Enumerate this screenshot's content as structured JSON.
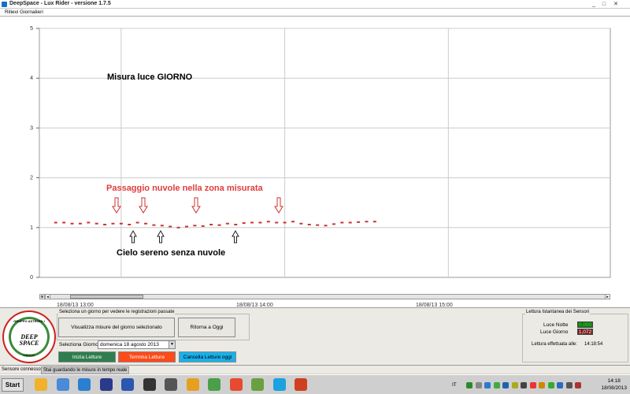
{
  "window": {
    "title": "DeepSpace - Lux Rider - versione 1.7.5"
  },
  "menu": {
    "item": "Rilievi Giornalieri"
  },
  "chart_data": {
    "type": "scatter",
    "title": "",
    "xlabel": "",
    "ylabel": "",
    "ylim": [
      0,
      5
    ],
    "yticks": [
      "0",
      "1",
      "2",
      "3",
      "4",
      "5"
    ],
    "xticks": [
      "18/08/13 13:00",
      "18/08/13 14:00",
      "18/08/13 15:00"
    ],
    "xrange_hours": [
      12.5,
      15.99
    ],
    "grid": true,
    "series": [
      {
        "color": "#cc3333",
        "x": [
          12.6,
          12.65,
          12.7,
          12.75,
          12.8,
          12.85,
          12.9,
          12.95,
          13.0,
          13.05,
          13.1,
          13.15,
          13.2,
          13.25,
          13.3,
          13.35,
          13.4,
          13.45,
          13.5,
          13.55,
          13.6,
          13.65,
          13.7,
          13.75,
          13.8,
          13.85,
          13.9,
          13.95,
          14.0,
          14.05,
          14.1,
          14.15,
          14.2,
          14.25,
          14.3,
          14.35,
          14.4,
          14.45,
          14.5,
          14.55
        ],
        "y": [
          1.1,
          1.1,
          1.08,
          1.08,
          1.1,
          1.08,
          1.06,
          1.08,
          1.08,
          1.06,
          1.1,
          1.08,
          1.05,
          1.04,
          1.02,
          1.0,
          1.02,
          1.04,
          1.03,
          1.06,
          1.05,
          1.08,
          1.06,
          1.09,
          1.1,
          1.1,
          1.12,
          1.1,
          1.1,
          1.12,
          1.08,
          1.06,
          1.05,
          1.04,
          1.07,
          1.1,
          1.1,
          1.11,
          1.12,
          1.12
        ]
      }
    ],
    "annotations": {
      "day": "Misura luce GIORNO",
      "clouds": "Passaggio nuvole nella  zona misurata",
      "clear": "Cielo sereno senza nuvole"
    }
  },
  "controls": {
    "group_past_label": "Seleziona un giorno per vedere le registrazioni passate",
    "view_button": "Visualizza misure del giorno selezionato",
    "today_button": "Ritorna a Oggi",
    "select_day_label": "Seleziona Giorno",
    "date_value": "domenica 18   agosto   2013",
    "start_button": "Inizia Letture",
    "stop_button": "Termina Letture",
    "delete_button": "Cancella Letture oggi",
    "colors": {
      "start": "#2f7d4f",
      "stop": "#ff4a1a",
      "delete": "#1ab0e8"
    }
  },
  "sensor": {
    "group_label": "Lettura Istantanea dei Sensori",
    "night_label": "Luce Notte",
    "night_value": "0,000",
    "day_label": "Luce Giorno",
    "day_value": "1,072",
    "time_label": "Lettura effettuata alle:",
    "time_value": "14:18:54"
  },
  "logo": {
    "top": "GRUPPO ASTROFILI",
    "word1": "DEEP",
    "word2": "SPACE",
    "bottom": "LECCO"
  },
  "status": {
    "connected": "Sensore connesso",
    "realtime": "Stai guardando le misure in tempo reale"
  },
  "taskbar": {
    "start": "Start",
    "lang": "IT",
    "time": "14:18",
    "date": "18/08/2013",
    "app_icons": [
      "messenger-icon",
      "folder-icon",
      "ie-icon",
      "deepspace-icon",
      "word-icon",
      "camera-icon",
      "search-icon",
      "media-icon",
      "image-icon",
      "chrome-icon",
      "pen-icon",
      "skype-icon",
      "archive-icon"
    ]
  }
}
